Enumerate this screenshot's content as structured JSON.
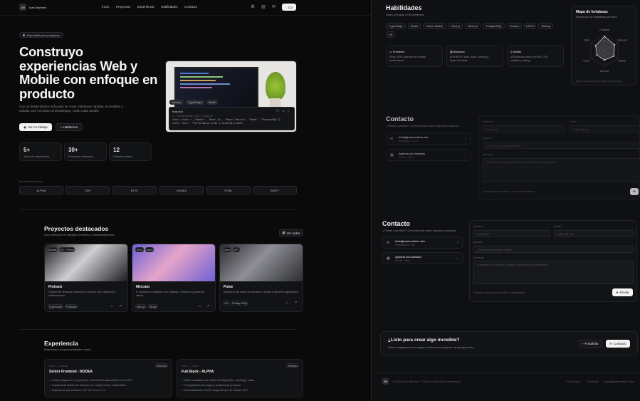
{
  "brand": {
    "initials": "JM",
    "name": "Juan Martínez"
  },
  "nav": [
    "Inicio",
    "Proyectos",
    "Experiencia",
    "Habilidades",
    "Contacto"
  ],
  "header": {
    "cv_label": "CV"
  },
  "hero": {
    "badge": "Disponible para proyectos",
    "title_lines": [
      "Construyo",
      "experiencias Web y",
      "Mobile con enfoque en",
      "producto"
    ],
    "desc_lines": [
      "Soy un desarrollador enfocado en crear interfaces rápidas, accesibles y",
      "pulidas. Del concepto al despliegue, cuido cada detalle."
    ],
    "btn_primary": "Ver mi trabajo",
    "btn_secondary": "Hablemos",
    "stats": [
      {
        "value": "5+",
        "label": "Años de experiencia"
      },
      {
        "value": "30+",
        "label": "Proyectos lanzados"
      },
      {
        "value": "12",
        "label": "Clientes felices"
      }
    ],
    "collab_label": "He colaborado con",
    "logos": [
      "ALPHA",
      "ZEN",
      "BYTE",
      "NODEA",
      "PIXEL",
      "SWIFT"
    ]
  },
  "code_card": {
    "tags": [
      "Next.js",
      "TypeScript",
      "Node"
    ],
    "title": "hola.tsxl",
    "lines": [
      "// Integración web & mobile",
      "const stack = [\"React\", \"Next.js\", \"React Native\", \"Node\", \"PostgreSQL\"];",
      "const foco = \"Performance & DX & accesibilidad\";"
    ]
  },
  "projects": {
    "title": "Proyectos destacados",
    "subtitle": "Una selección de trabajos recientes y multidisciplinares.",
    "view_all": "Ver todos",
    "items": [
      {
        "tags": [
          "Mobile",
          "UX + Proto"
        ],
        "name": "Fintrack",
        "desc": [
          "Gestión de finanzas personal en tiempo real, objetivos y",
          "notificaciones."
        ],
        "stack": [
          "TypeScript",
          "Firebase"
        ],
        "color1": "#1a1a1c",
        "color2": "#cfcfd2"
      },
      {
        "tags": [
          "Web",
          "SaaS"
        ],
        "name": "Mercato",
        "desc": [
          "E-commerce headless con catálogo, checkout y panel de",
          "admin."
        ],
        "stack": [
          "Next.js",
          "Stripe"
        ],
        "color1": "#6b5fd6",
        "color2": "#e6a5c9"
      },
      {
        "tags": [
          "Dash",
          "API"
        ],
        "name": "Pulse",
        "desc": [
          "Monitoreo de salud de servicios, alertas y reportes agendados."
        ],
        "stack": [
          "Go",
          "PostgreSQL"
        ],
        "color1": "#2b2c30",
        "color2": "#8e8f95"
      }
    ]
  },
  "experience": {
    "title": "Experiencia",
    "subtitle": "Empresas y responsabilidades clave.",
    "items": [
      {
        "period": "2023 — Actual",
        "role": "Senior Frontend - NODEA",
        "badge": "Remoto",
        "bullets": [
          "Lideré migración a TypeScript, reduciendo bugs críticos en un 30%.",
          "Implementé diseño de sistema con componentes reutilizables.",
          "Mejoras de performance LCP de 3.2s a 1.7s."
        ]
      },
      {
        "period": "2021 — 2023",
        "role": "Full-Stack - ALPHA",
        "badge": "Híbrido",
        "bullets": [
          "APIs escalables con Node & PostgreSQL, caching y colas.",
          "Integraciones de pagos y analítica de producto.",
          "Automatización CI/CD redujo tiempo de release 40%."
        ]
      }
    ]
  },
  "skills": {
    "title": "Habilidades",
    "subtitle": "Stack principal y herramientas",
    "tags": [
      "TypeScript",
      "React",
      "React Native",
      "Next.js",
      "Node.js",
      "PostgreSQL",
      "Docker",
      "CI/CD",
      "Testing",
      "UX"
    ],
    "cards": [
      {
        "title": "Frontend",
        "desc": [
          "SPAs, SSR, patrones de estado,",
          "performance."
        ]
      },
      {
        "title": "Backend",
        "desc": [
          "APIs REST, auth, colas, caching y",
          "bases de datos."
        ]
      },
      {
        "title": "Mobile",
        "desc": [
          "iOS/Android nativo con RN, OTA",
          "updates y testing."
        ]
      }
    ],
    "radar": {
      "title": "Mapa de fortalezas",
      "subtitle": "Distribución de habilidades por área",
      "axes": [
        "Frontend",
        "Backend",
        "Mobile",
        "DevOps",
        "UX/UI",
        "Data"
      ],
      "values": [
        0.9,
        0.75,
        0.7,
        0.6,
        0.55,
        0.65
      ],
      "footnote": "Valores relativos sobre un máximo de 10 puntos."
    }
  },
  "contact": {
    "title": "Contacto",
    "subtitle": "¿Tienes una idea? Conversemos sobre impacto y alcance.",
    "email_title": "hola@juanmartinez.dev",
    "email_sub": "Respuesta en 24h",
    "meet_title": "Agenda una llamada",
    "meet_sub": "15 min · Meet",
    "name_label": "Nombre",
    "name_placeholder": "Tu nombre",
    "email_label": "Email",
    "email_placeholder": "tu@email.com",
    "subject_label": "Asunto",
    "subject_placeholder": "¿Sobre qué te gustaría hablar?",
    "message_label": "Mensaje",
    "message_placeholder": "Cuéntame de tu proyecto, timeline, restricciones, expectativas.",
    "footnote": "Protegido con protocolos y sin tu consentimiento.",
    "send_label": "Enviar"
  },
  "cta": {
    "title": "¿Listo para crear algo increíble?",
    "subtitle": "Puedo integrarme a tu equipo o liderar un proyecto de principio a fin.",
    "portfolio_label": "Portafolio",
    "contact_label": "Contacto"
  },
  "footer": {
    "initials": "JM",
    "copyright": "© 2025 Juan Martínez. Todos los derechos reservados.",
    "links": [
      "Privacidad",
      "Términos",
      "hola@juanmartinez.dev"
    ]
  }
}
